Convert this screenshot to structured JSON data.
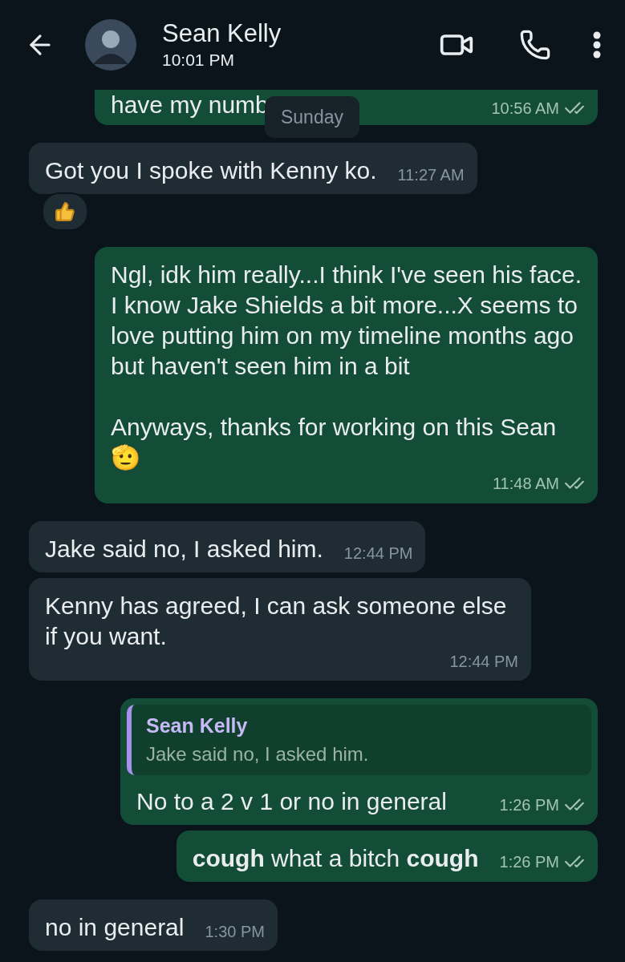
{
  "header": {
    "contact_name": "Sean Kelly",
    "status": "10:01 PM"
  },
  "date_chip": "Sunday",
  "messages": [
    {
      "kind": "sent",
      "text": "have my numb",
      "time": "10:56 AM",
      "read": false
    },
    {
      "kind": "received",
      "text": "Got you I spoke with Kenny ko.",
      "time": "11:27 AM",
      "reaction": {
        "kind": "thumbs-up"
      }
    },
    {
      "kind": "sent",
      "text": "Ngl, idk him really...I think I've seen his face. I know Jake Shields a bit more...X seems to love putting him on my timeline months ago but haven't seen him in a bit\n\nAnyways, thanks for working on this Sean 🫡",
      "time": "11:48 AM",
      "read": false
    },
    {
      "kind": "received",
      "text": "Jake said no, I asked him.",
      "time": "12:44 PM"
    },
    {
      "kind": "received",
      "text": "Kenny has agreed, I can ask someone else if you want.",
      "time": "12:44 PM"
    },
    {
      "kind": "sent",
      "quote": {
        "author": "Sean Kelly",
        "text": "Jake said no, I asked him."
      },
      "text": "No to a 2 v 1 or no in general",
      "time": "1:26 PM",
      "read": false
    },
    {
      "kind": "sent",
      "text": "**cough** what a bitch **cough**",
      "time": "1:26 PM",
      "read": false
    },
    {
      "kind": "received",
      "text": "no in general",
      "time": "1:30 PM"
    }
  ]
}
